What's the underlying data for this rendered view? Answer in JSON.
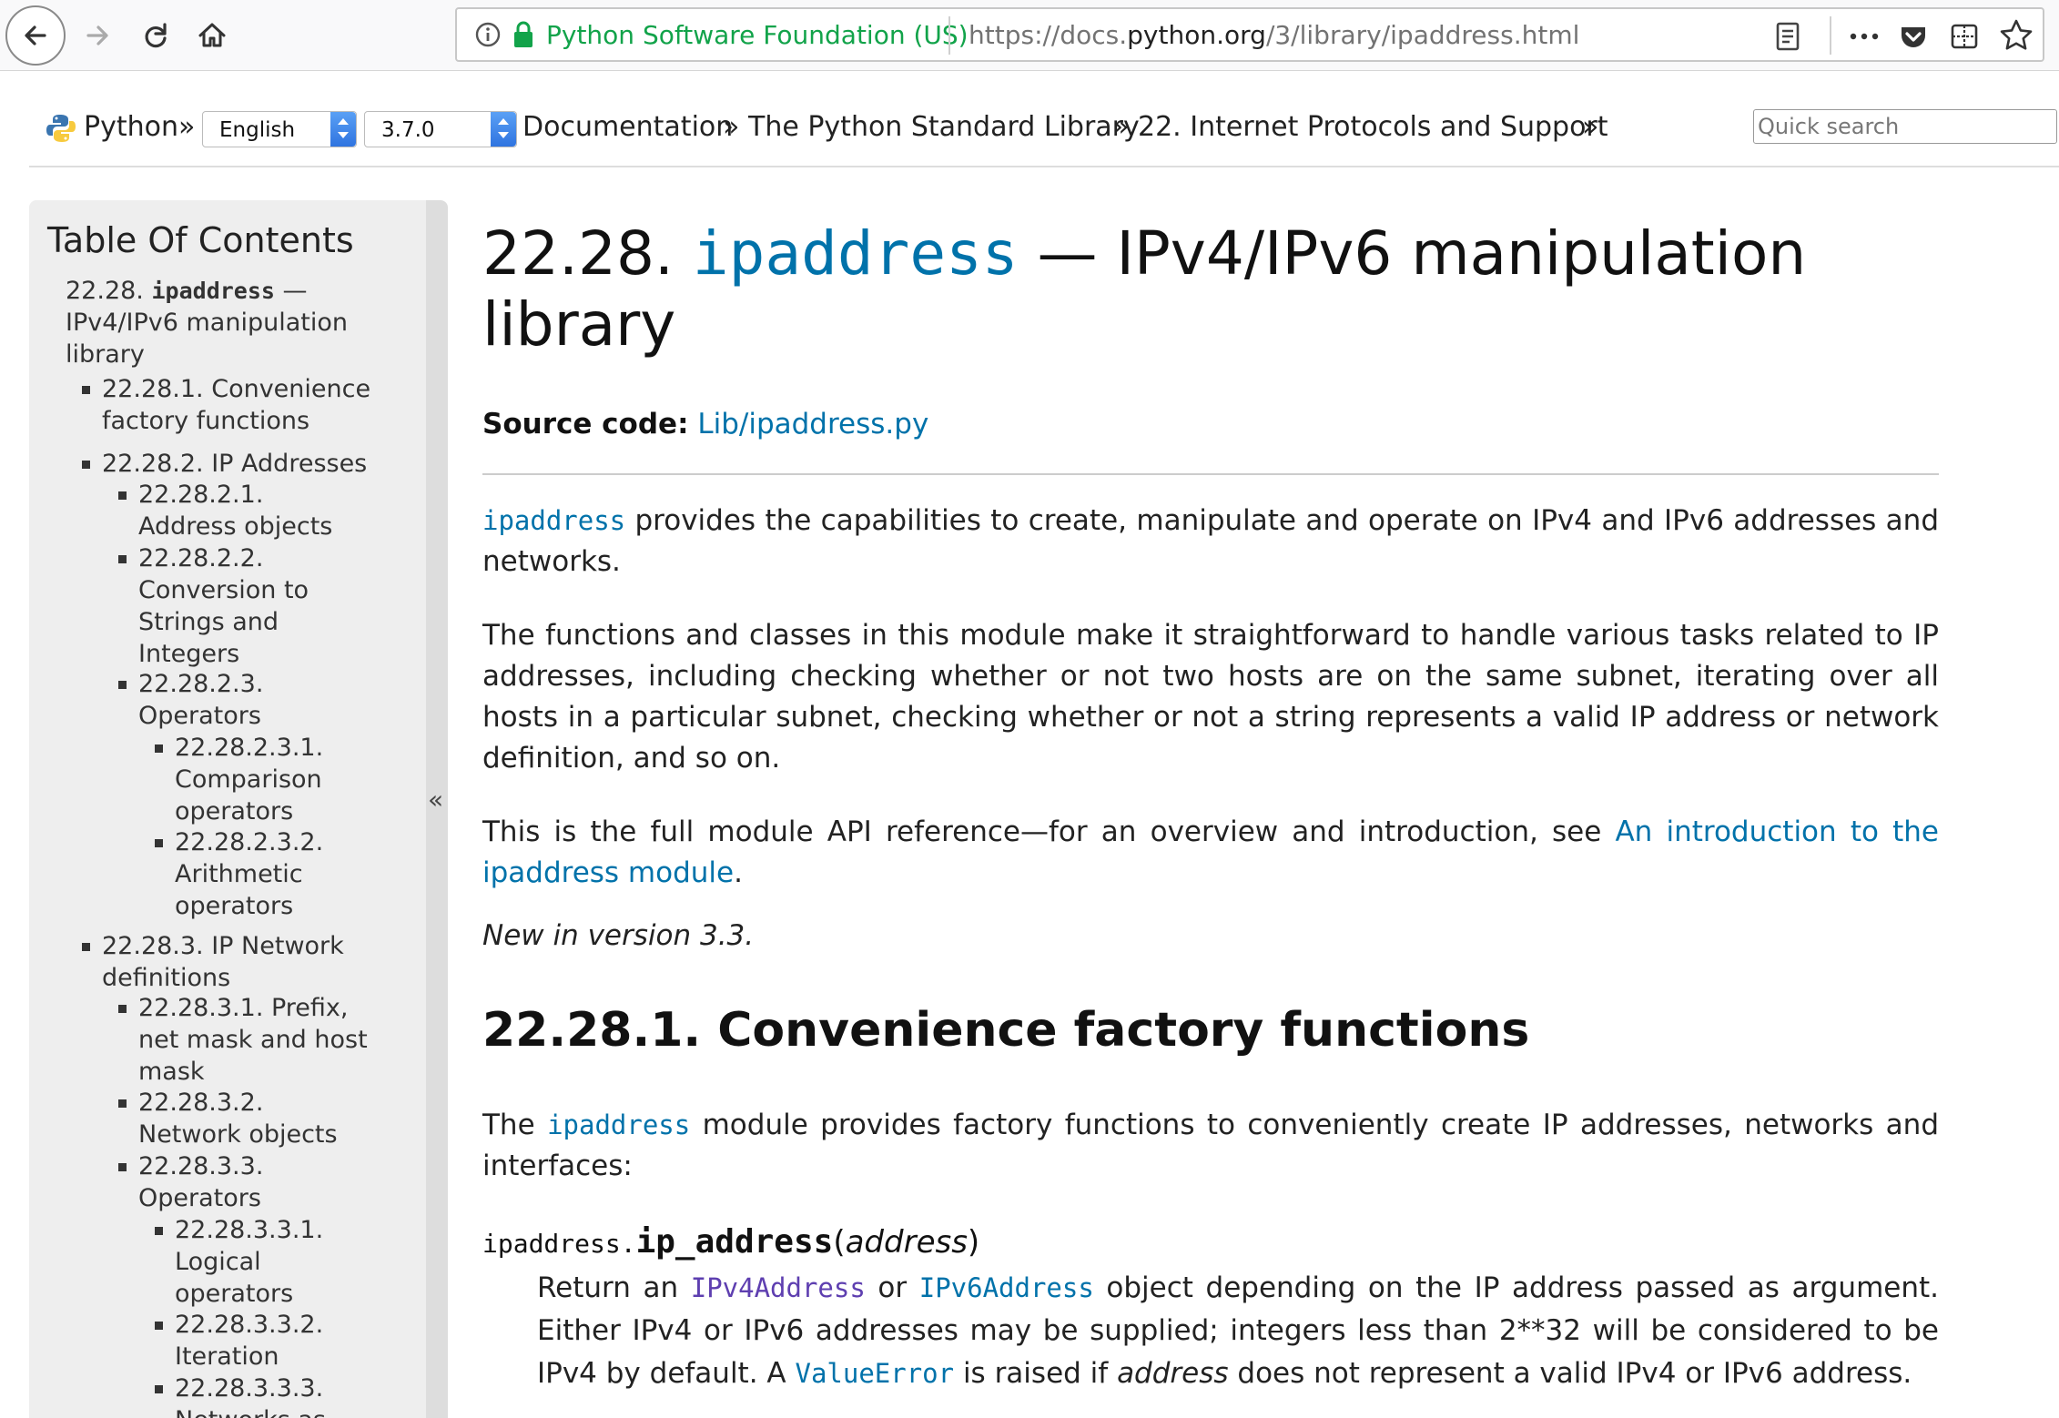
{
  "browser": {
    "site_identity": "Python Software Foundation (US)",
    "url_prefix": "https://docs.",
    "url_domain": "python.org",
    "url_path": "/3/library/ipaddress.html"
  },
  "header": {
    "python_label": "Python",
    "sep": "»",
    "language_select": "English",
    "version_select": "3.7.0",
    "breadcrumbs": [
      "Documentation",
      "The Python Standard Library",
      "22. Internet Protocols and Support"
    ],
    "search_placeholder": "Quick search"
  },
  "sidebar": {
    "title": "Table Of Contents",
    "collapse_label": "«",
    "items": [
      {
        "num": "22.28.",
        "mono": "ipaddress",
        "rest": "—",
        "line2": "IPv4/IPv6 manipulation",
        "line3": "library"
      },
      {
        "l1": "22.28.1. Convenience",
        "l2": "factory functions"
      },
      {
        "l1": "22.28.2. IP Addresses"
      },
      {
        "l1": "22.28.2.1.",
        "l2": "Address objects"
      },
      {
        "l1": "22.28.2.2.",
        "l2": "Conversion to",
        "l3": "Strings and",
        "l4": "Integers"
      },
      {
        "l1": "22.28.2.3.",
        "l2": "Operators"
      },
      {
        "l1": "22.28.2.3.1.",
        "l2": "Comparison",
        "l3": "operators"
      },
      {
        "l1": "22.28.2.3.2.",
        "l2": "Arithmetic",
        "l3": "operators"
      },
      {
        "l1": "22.28.3. IP Network",
        "l2": "definitions"
      },
      {
        "l1": "22.28.3.1. Prefix,",
        "l2": "net mask and host",
        "l3": "mask"
      },
      {
        "l1": "22.28.3.2.",
        "l2": "Network objects"
      },
      {
        "l1": "22.28.3.3.",
        "l2": "Operators"
      },
      {
        "l1": "22.28.3.3.1.",
        "l2": "Logical",
        "l3": "operators"
      },
      {
        "l1": "22.28.3.3.2.",
        "l2": "Iteration"
      },
      {
        "l1": "22.28.3.3.3.",
        "l2": "Networks as"
      }
    ]
  },
  "main": {
    "title_num": "22.28.",
    "title_module": "ipaddress",
    "title_rest": " — IPv4/IPv6 manipulation library",
    "source_label": "Source code:",
    "source_link": "Lib/ipaddress.py",
    "p1_code": "ipaddress",
    "p1_text": " provides the capabilities to create, manipulate and operate on IPv4 and IPv6 addresses and networks.",
    "p2": "The functions and classes in this module make it straightforward to handle various tasks related to IP addresses, including checking whether or not two hosts are on the same subnet, iterating over all hosts in a particular subnet, checking whether or not a string represents a valid IP address or network definition, and so on.",
    "p3_text": "This is the full module API reference—for an overview and introduction, see ",
    "p3_link": "An introduction to the ipaddress module",
    "p3_end": ".",
    "new_in": "New in version 3.3.",
    "section_title": "22.28.1. Convenience factory functions",
    "p4_a": "The ",
    "p4_code": "ipaddress",
    "p4_b": " module provides factory functions to conveniently create IP addresses, networks and interfaces:",
    "func_prefix": "ipaddress.",
    "func_name": "ip_address",
    "func_open": "(",
    "func_arg": "address",
    "func_close": ")",
    "desc_a": "Return an ",
    "desc_code1": "IPv4Address",
    "desc_b": " or ",
    "desc_code2": "IPv6Address",
    "desc_c": " object depending on the IP address passed as argument. Either IPv4 or IPv6 addresses may be supplied; integers less than 2**32 will be considered to be IPv4 by default. A ",
    "desc_code3": "ValueError",
    "desc_d": " is raised if ",
    "desc_em": "address",
    "desc_e": " does not represent a valid IPv4 or IPv6 address."
  },
  "colors": {
    "link": "#0072aa",
    "secure_green": "#12a34a",
    "sidebar_bg": "#eeeeee"
  }
}
